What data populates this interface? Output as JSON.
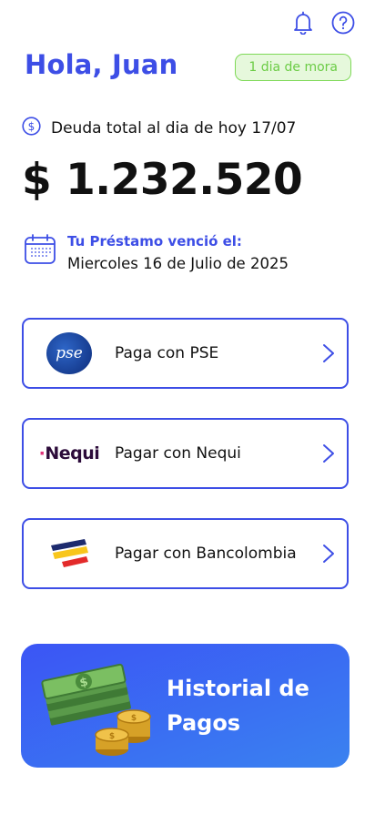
{
  "header": {
    "icons": [
      "bell-icon",
      "help-icon"
    ],
    "greeting": "Hola, Juan",
    "mora_badge": "1 dia de mora"
  },
  "debt": {
    "label": "Deuda total al dia de hoy 17/07",
    "amount": "$ 1.232.520",
    "icon": "dollar-circle-icon"
  },
  "due": {
    "icon": "calendar-icon",
    "title": "Tu Préstamo venció el:",
    "date": "Miercoles 16 de Julio de 2025"
  },
  "payment_options": [
    {
      "label": "Paga  con PSE",
      "logo_text": "pse"
    },
    {
      "label": "Pagar con Nequi",
      "logo_text": "Nequi"
    },
    {
      "label": "Pagar con Bancolombia"
    }
  ],
  "history": {
    "title": "Historial de Pagos"
  },
  "colors": {
    "primary": "#3d4ee6",
    "badge_text": "#6bcc45",
    "badge_bg": "#e6f8dc",
    "history_gradient_start": "#3b55f5",
    "history_gradient_end": "#3a82f0"
  }
}
